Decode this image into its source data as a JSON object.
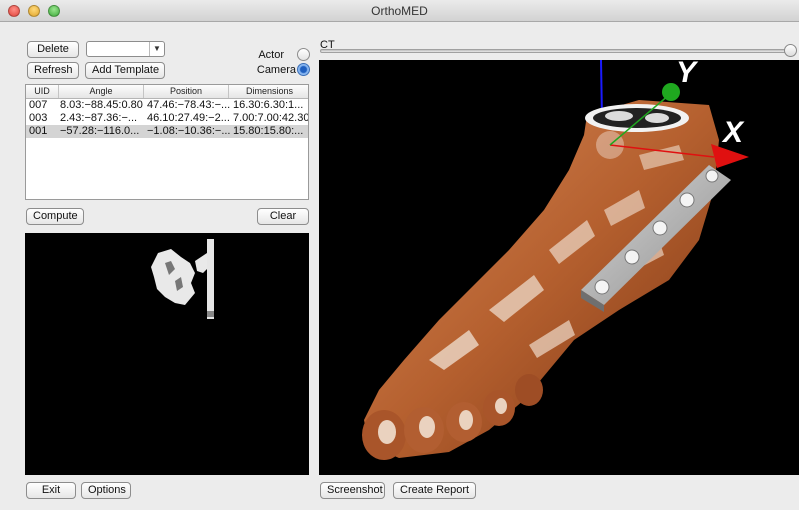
{
  "window": {
    "title": "OrthoMED"
  },
  "toolbar": {
    "delete_label": "Delete",
    "refresh_label": "Refresh",
    "add_template_label": "Add Template",
    "template_select_value": ""
  },
  "mode": {
    "actor_label": "Actor",
    "camera_label": "Camera",
    "selected": "Camera"
  },
  "table": {
    "columns": [
      "UID",
      "Angle",
      "Position",
      "Dimensions"
    ],
    "rows": [
      {
        "uid": "007",
        "angle": "8.03:−88.45:0.80",
        "position": "47.46:−78.43:−...",
        "dimensions": "16.30:6.30:1...",
        "selected": false
      },
      {
        "uid": "003",
        "angle": "2.43:−87.36:−...",
        "position": "46.10:27.49:−2...",
        "dimensions": "7.00:7.00:42.30",
        "selected": false
      },
      {
        "uid": "001",
        "angle": "−57.28:−116.0...",
        "position": "−1.08:−10.36:−...",
        "dimensions": "15.80:15.80:...",
        "selected": true
      }
    ]
  },
  "actions": {
    "compute_label": "Compute",
    "clear_label": "Clear"
  },
  "footer": {
    "exit_label": "Exit",
    "options_label": "Options",
    "screenshot_label": "Screenshot",
    "create_report_label": "Create Report"
  },
  "ct": {
    "label": "CT",
    "level": 1.0
  },
  "viewport": {
    "axis_x_label": "X",
    "axis_y_label": "Y",
    "background": "#000000"
  },
  "colors": {
    "skin": "#b4602f",
    "bone": "#ead2bf",
    "plate": "#b9b9b9",
    "axis_x": "#e01010",
    "axis_y": "#1fa81f",
    "axis_z": "#1a1aff",
    "radio_selected": "#1f5fbf"
  }
}
